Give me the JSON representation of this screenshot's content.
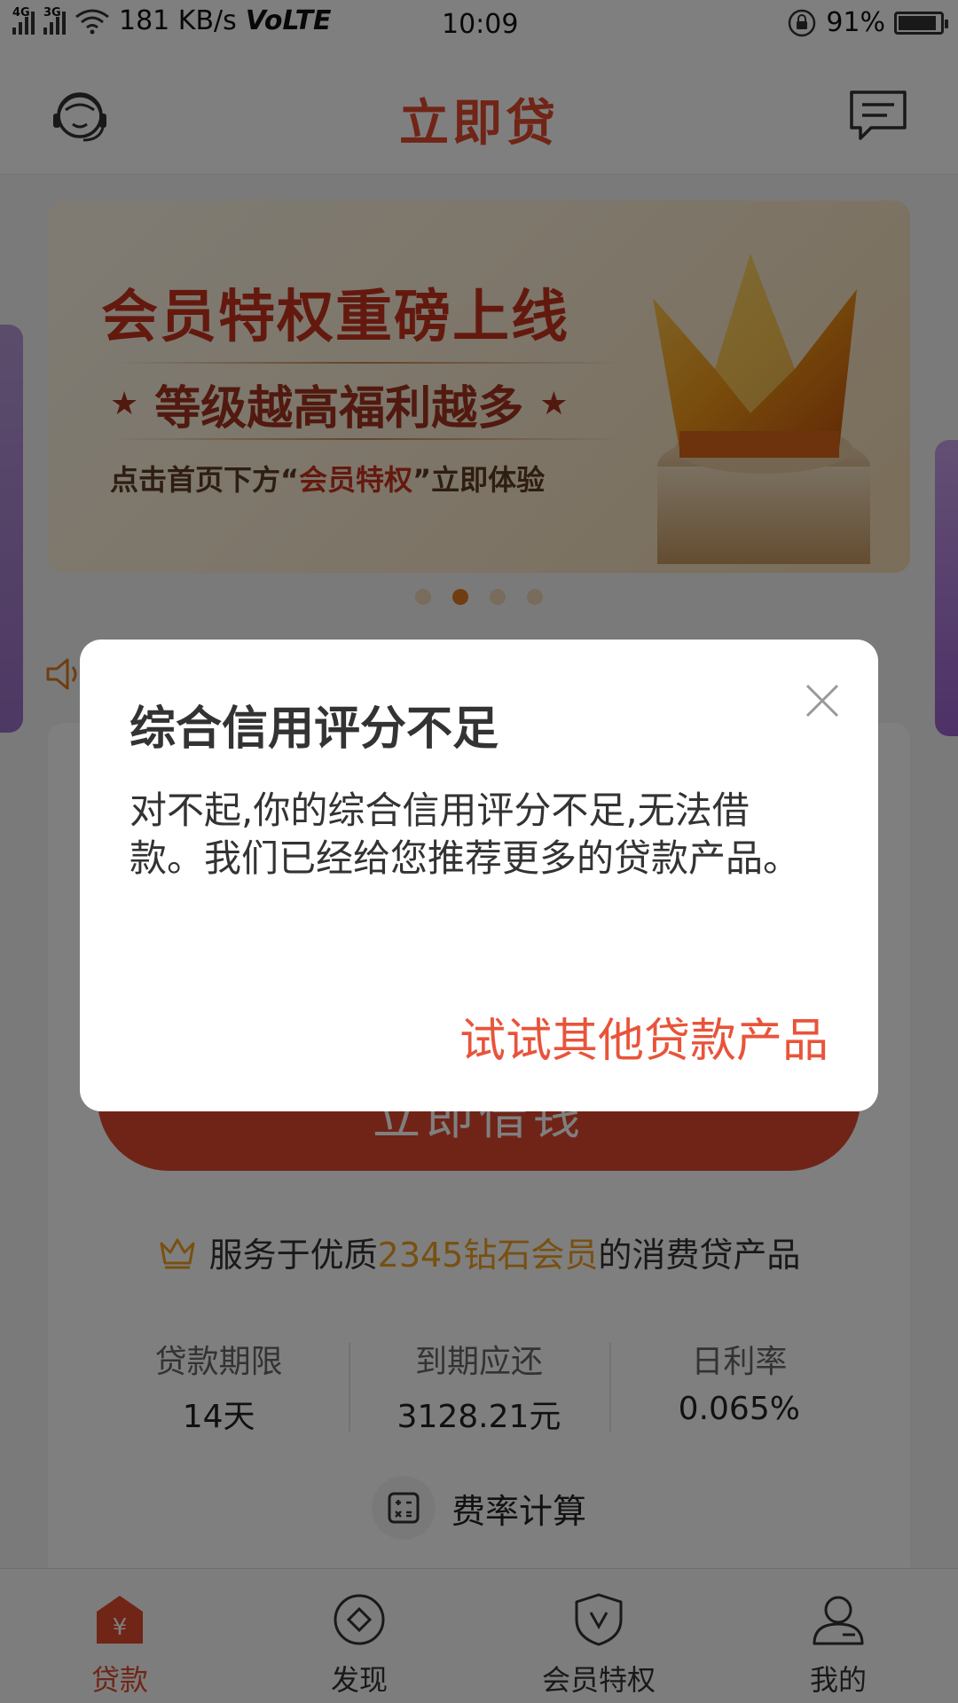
{
  "status_bar": {
    "net1": "4G",
    "net2": "3G",
    "speed": "181 KB/s",
    "volte": "VoLTE",
    "time": "10:09",
    "battery_pct": "91%",
    "battery_level": 0.91
  },
  "header": {
    "title": "立即贷",
    "left_icon": "customer-service-icon",
    "right_icon": "message-icon"
  },
  "banner": {
    "headline": "会员特权重磅上线",
    "subline": "等级越高福利越多",
    "line3_pre": "点击首页下方“",
    "line3_highlight": "会员特权",
    "line3_post": "”立即体验",
    "dots_count": 4,
    "active_dot": 1
  },
  "card": {
    "borrow_button": "立即借钱",
    "member_prefix": "服务于优质",
    "member_highlight": "2345钻石会员",
    "member_suffix": "的消费贷产品",
    "stats": [
      {
        "label": "贷款期限",
        "value": "14天"
      },
      {
        "label": "到期应还",
        "value": "3128.21元"
      },
      {
        "label": "日利率",
        "value": "0.065%"
      }
    ],
    "rate_calc": "费率计算"
  },
  "tabs": [
    {
      "label": "贷款",
      "icon": "loan-yen-icon",
      "active": true
    },
    {
      "label": "发现",
      "icon": "discover-icon",
      "active": false
    },
    {
      "label": "会员特权",
      "icon": "vip-shield-icon",
      "active": false
    },
    {
      "label": "我的",
      "icon": "profile-icon",
      "active": false
    }
  ],
  "dialog": {
    "title": "综合信用评分不足",
    "body": "对不起,你的综合信用评分不足,无法借款。我们已经给您推荐更多的贷款产品。",
    "action": "试试其他贷款产品"
  },
  "colors": {
    "brand": "#e14b2e",
    "highlight": "#f0a020",
    "dialog_action": "#e8543a"
  }
}
